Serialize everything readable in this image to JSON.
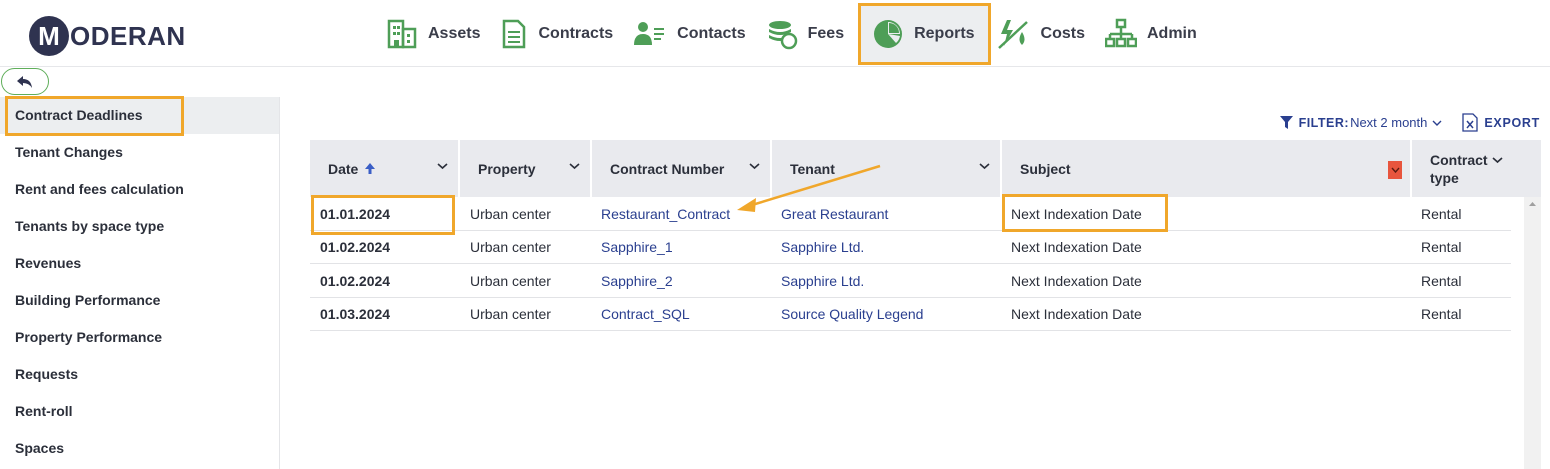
{
  "brand": {
    "logo_letter": "M",
    "logo_text": "ODERAN"
  },
  "nav": {
    "items": [
      {
        "label": "Assets",
        "icon": "building-icon"
      },
      {
        "label": "Contracts",
        "icon": "document-icon"
      },
      {
        "label": "Contacts",
        "icon": "contacts-icon"
      },
      {
        "label": "Fees",
        "icon": "coins-icon"
      },
      {
        "label": "Reports",
        "icon": "pie-chart-icon",
        "active": true
      },
      {
        "label": "Costs",
        "icon": "utilities-icon"
      },
      {
        "label": "Admin",
        "icon": "org-chart-icon"
      }
    ]
  },
  "sidebar": {
    "items": [
      {
        "label": "Contract Deadlines",
        "active": true
      },
      {
        "label": "Tenant Changes"
      },
      {
        "label": "Rent and fees calculation"
      },
      {
        "label": "Tenants by space type"
      },
      {
        "label": "Revenues"
      },
      {
        "label": "Building Performance"
      },
      {
        "label": "Property Performance"
      },
      {
        "label": "Requests"
      },
      {
        "label": "Rent-roll"
      },
      {
        "label": "Spaces"
      }
    ]
  },
  "toolbar": {
    "filter_label": "FILTER:",
    "filter_value": "Next 2 month",
    "export_label": "EXPORT"
  },
  "table": {
    "columns": [
      {
        "label": "Date",
        "sorted": "asc"
      },
      {
        "label": "Property"
      },
      {
        "label": "Contract Number"
      },
      {
        "label": "Tenant"
      },
      {
        "label": "Subject"
      },
      {
        "label": "Contract type"
      }
    ],
    "rows": [
      {
        "date": "01.01.2024",
        "property": "Urban center",
        "contract": "Restaurant_Contract",
        "tenant": "Great Restaurant",
        "subject": "Next Indexation Date",
        "type": "Rental"
      },
      {
        "date": "01.02.2024",
        "property": "Urban center",
        "contract": "Sapphire_1",
        "tenant": "Sapphire Ltd.",
        "subject": "Next Indexation Date",
        "type": "Rental"
      },
      {
        "date": "01.02.2024",
        "property": "Urban center",
        "contract": "Sapphire_2",
        "tenant": "Sapphire Ltd.",
        "subject": "Next Indexation Date",
        "type": "Rental"
      },
      {
        "date": "01.03.2024",
        "property": "Urban center",
        "contract": "Contract_SQL",
        "tenant": "Source Quality Legend",
        "subject": "Next Indexation Date",
        "type": "Rental"
      }
    ]
  },
  "colors": {
    "accent_highlight": "#f0a72b",
    "brand_dark": "#2f3350",
    "link": "#2a3f8f",
    "nav_icon_green": "#4e9e57"
  }
}
